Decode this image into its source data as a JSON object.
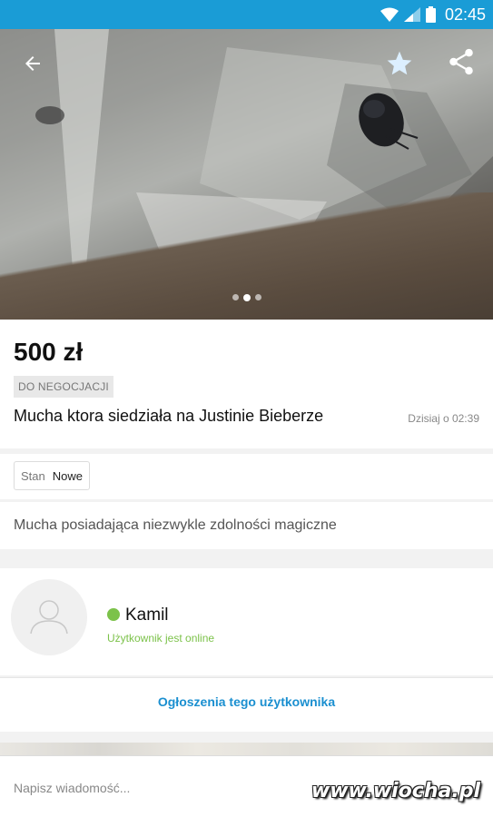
{
  "status_bar": {
    "time": "02:45",
    "color": "#1a9cd6"
  },
  "hero": {
    "back_icon": "arrow-back-icon",
    "favorite_icon": "star-icon",
    "share_icon": "share-icon",
    "photo_count": 3,
    "active_photo_index": 1
  },
  "listing": {
    "price": "500 zł",
    "negotiable_badge": "DO NEGOCJACJI",
    "title": "Mucha ktora siedziała na Justinie Bieberze",
    "posted": "Dzisiaj o 02:39",
    "condition_label": "Stan",
    "condition_value": "Nowe",
    "description": "Mucha posiadająca niezwykle zdolności magiczne"
  },
  "seller": {
    "name": "Kamil",
    "status": "Użytkownik jest online",
    "status_color": "#7cc24a",
    "ads_link": "Ogłoszenia tego użytkownika"
  },
  "composer": {
    "placeholder": "Napisz wiadomość..."
  },
  "watermark": "www.wiocha.pl"
}
